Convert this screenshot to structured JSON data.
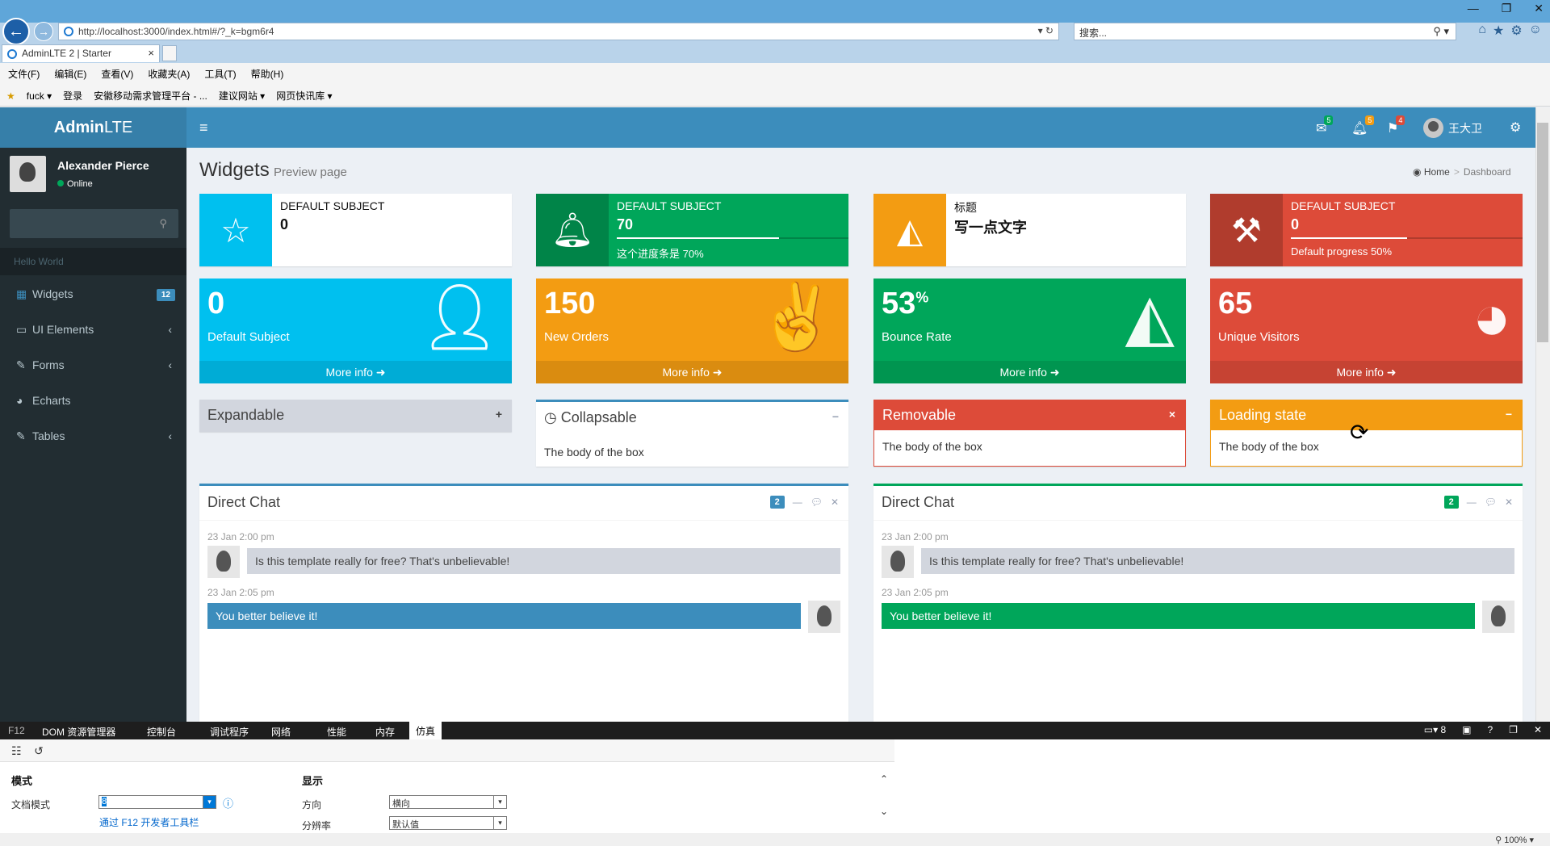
{
  "browser": {
    "url": "http://localhost:3000/index.html#/?_k=bgm6r4",
    "search_placeholder": "搜索...",
    "tab_title": "AdminLTE 2 | Starter",
    "menu": [
      "文件(F)",
      "编辑(E)",
      "查看(V)",
      "收藏夹(A)",
      "工具(T)",
      "帮助(H)"
    ],
    "favorites": [
      "fuck ▾",
      "登录",
      "安徽移动需求管理平台 - ...",
      "建议网站 ▾",
      "网页快讯库 ▾"
    ]
  },
  "header": {
    "logo_bold": "Admin",
    "logo_light": "LTE",
    "messages_count": "5",
    "notifications_count": "5",
    "tasks_count": "4",
    "user_name": "王大卫"
  },
  "sidebar": {
    "user_name": "Alexander Pierce",
    "status": "Online",
    "header": "Hello World",
    "items": [
      {
        "label": "Widgets",
        "icon": "th-icon",
        "badge": "12"
      },
      {
        "label": "UI Elements",
        "icon": "laptop-icon"
      },
      {
        "label": "Forms",
        "icon": "edit-icon"
      },
      {
        "label": "Echarts",
        "icon": "pie-chart-icon"
      },
      {
        "label": "Tables",
        "icon": "edit-icon"
      }
    ]
  },
  "page": {
    "title": "Widgets",
    "subtitle": "Preview page",
    "breadcrumb_home": "Home",
    "breadcrumb_current": "Dashboard"
  },
  "info_boxes": [
    {
      "text": "DEFAULT SUBJECT",
      "number": "0",
      "icon": "star-icon",
      "color": "#00c0ef"
    },
    {
      "text": "DEFAULT SUBJECT",
      "number": "70",
      "icon": "bell-icon",
      "color": "#00a65a",
      "progress": 0.7,
      "desc": "这个进度条是 70%"
    },
    {
      "text": "标题",
      "number": "写一点文字",
      "icon": "area-chart-icon",
      "color": "#f39c12"
    },
    {
      "text": "DEFAULT SUBJECT",
      "number": "0",
      "icon": "gavel-icon",
      "color": "#dd4b39",
      "progress": 0.5,
      "desc": "Default progress 50%"
    }
  ],
  "small_boxes": [
    {
      "number": "0",
      "suffix": "",
      "label": "Default Subject",
      "icon": "user-plus-icon",
      "footer": "More info ➜",
      "color": "#00c0ef"
    },
    {
      "number": "150",
      "suffix": "",
      "label": "New Orders",
      "icon": "hand-peace-icon",
      "footer": "More info ➜",
      "color": "#f39c12"
    },
    {
      "number": "53",
      "suffix": "%",
      "label": "Bounce Rate",
      "icon": "area-chart-icon",
      "footer": "More info ➜",
      "color": "#00a65a"
    },
    {
      "number": "65",
      "suffix": "",
      "label": "Unique Visitors",
      "icon": "pie-chart-icon",
      "footer": "More info ➜",
      "color": "#dd4b39"
    }
  ],
  "boxes": [
    {
      "title": "Expandable",
      "tool": "+",
      "body": ""
    },
    {
      "title": "Collapsable",
      "tool": "−",
      "body": "The body of the box"
    },
    {
      "title": "Removable",
      "tool": "×",
      "body": "The body of the box"
    },
    {
      "title": "Loading state",
      "tool": "−",
      "body": "The body of the box"
    }
  ],
  "chats": [
    {
      "title": "Direct Chat",
      "count": "2",
      "color": "#3c8dbc",
      "messages": [
        {
          "time": "23 Jan 2:00 pm",
          "text": "Is this template really for free? That's unbelievable!"
        },
        {
          "time": "23 Jan 2:05 pm",
          "text": "You better believe it!"
        }
      ]
    },
    {
      "title": "Direct Chat",
      "count": "2",
      "color": "#00a65a",
      "messages": [
        {
          "time": "23 Jan 2:00 pm",
          "text": "Is this template really for free? That's unbelievable!"
        },
        {
          "time": "23 Jan 2:05 pm",
          "text": "You better believe it!"
        }
      ]
    }
  ],
  "devtools": {
    "tabs": [
      "F12",
      "DOM 资源管理器",
      "控制台",
      "调试程序",
      "网络",
      "性能",
      "内存",
      "仿真"
    ],
    "doc_mode_value": "8",
    "mode_header": "模式",
    "doc_mode_label": "文档模式",
    "doc_mode_note": "通过 F12 开发者工具栏",
    "display_header": "显示",
    "orientation_label": "方向",
    "orientation_value": "横向",
    "resolution_label": "分辨率",
    "resolution_value": "默认值",
    "zoom": "100%"
  }
}
